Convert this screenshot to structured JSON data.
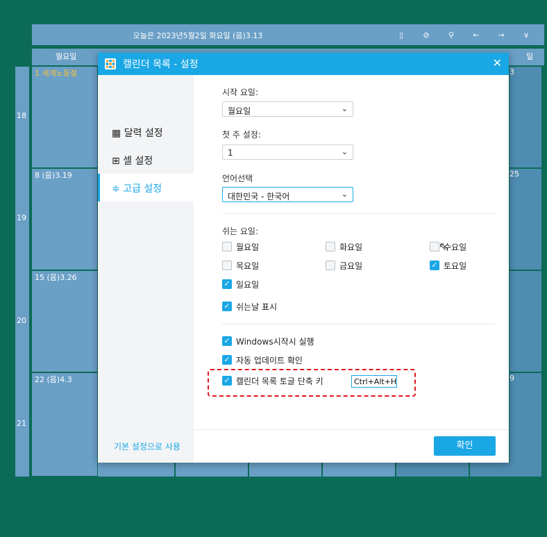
{
  "calendar": {
    "today_text": "오늘은 2023년5월2일 화요일 (음)3.13",
    "weekday_first": "월요일",
    "weekday_last_partial": "일",
    "week_numbers": [
      "18",
      "19",
      "20",
      "21"
    ],
    "day_labels": [
      "1 세계노동절",
      "8 (음)3.19",
      "15 (음)3.26",
      "22 (음)4.3"
    ],
    "right_partial_labels": [
      "3",
      "25",
      "9"
    ]
  },
  "dialog": {
    "title": "캘린더 목록 - 설정",
    "close_glyph": "✕",
    "sidebar": [
      {
        "icon": "calendar-icon",
        "glyph": "▦",
        "label": "달력 설정"
      },
      {
        "icon": "grid-icon",
        "glyph": "⊞",
        "label": "셀 설정"
      },
      {
        "icon": "sliders-icon",
        "glyph": "≑",
        "label": "고급 설정"
      }
    ],
    "start_day": {
      "label": "시작 요일:",
      "value": "월요일"
    },
    "first_week": {
      "label": "첫 주 설정:",
      "value": "1"
    },
    "language": {
      "label": "언어선택",
      "value": "대한민국 - 한국어"
    },
    "rest_days": {
      "label": "쉬는 요일:",
      "days": [
        {
          "label": "월요일",
          "checked": false
        },
        {
          "label": "화요일",
          "checked": false
        },
        {
          "label": "수요일",
          "checked": false
        },
        {
          "label": "목요일",
          "checked": false
        },
        {
          "label": "금요일",
          "checked": false
        },
        {
          "label": "토요일",
          "checked": true
        },
        {
          "label": "일요일",
          "checked": true
        }
      ]
    },
    "show_rest_days": {
      "label": "쉬는날 표시",
      "checked": true
    },
    "run_on_startup": {
      "label": "Windows시작시 실행",
      "checked": true
    },
    "auto_update": {
      "label": "자동 업데이트 확인",
      "checked": true
    },
    "toggle_hotkey": {
      "label": "캘린더 목록 토글 단축 키",
      "checked": true,
      "value": "Ctrl+Alt+H"
    },
    "reset_link": "기본 설정으로 사용",
    "ok_button": "확인"
  },
  "colors": {
    "accent": "#1aa7e5",
    "background": "#0b6b56",
    "calendar": "#6a9fc6",
    "highlight": "#e0141e"
  }
}
